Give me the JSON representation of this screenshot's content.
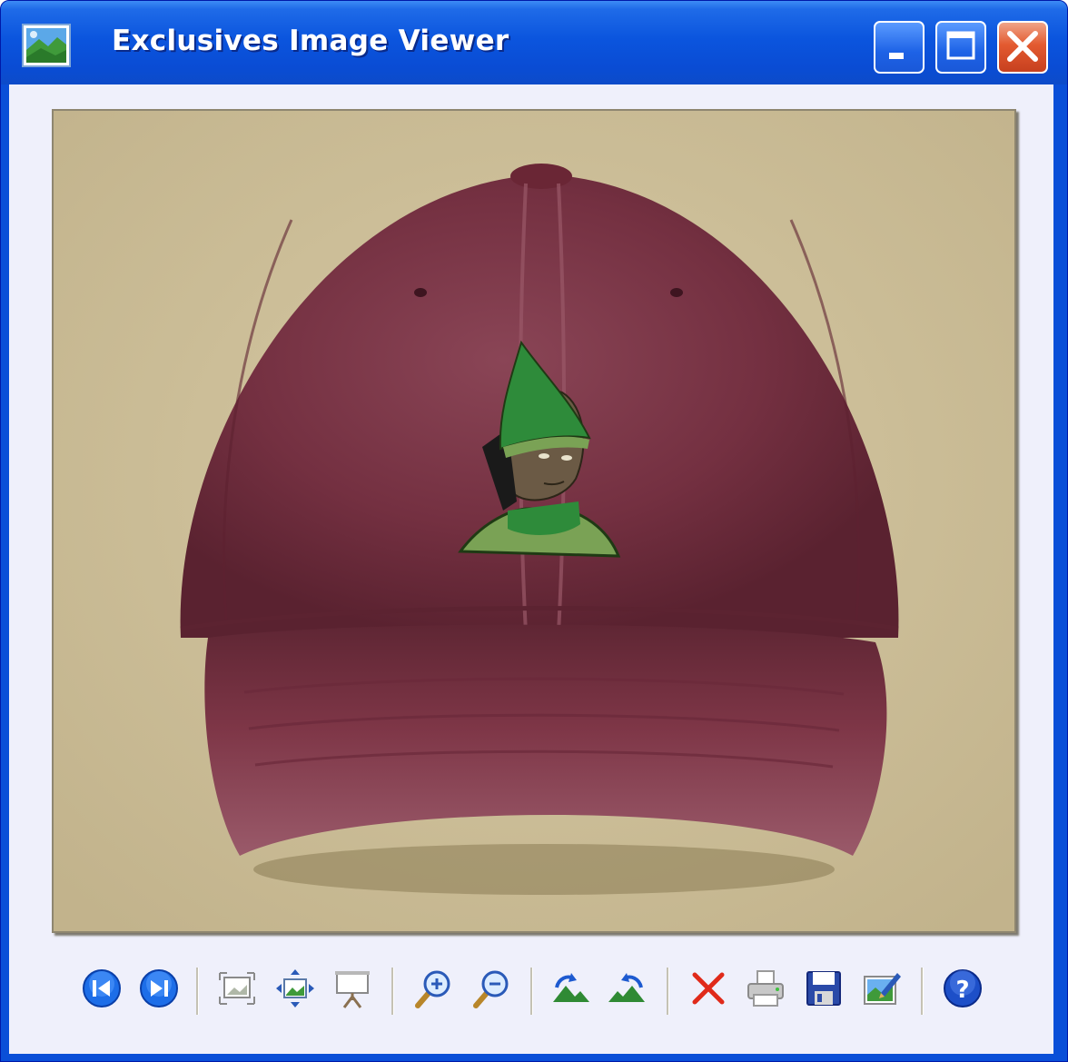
{
  "window": {
    "title": "Exclusives Image Viewer",
    "accent": "#0a4fd8"
  },
  "titlebar_buttons": [
    {
      "name": "minimize-button",
      "icon": "minimize-icon"
    },
    {
      "name": "maximize-button",
      "icon": "maximize-icon"
    },
    {
      "name": "close-button",
      "icon": "close-icon"
    }
  ],
  "image": {
    "subject": "hat-photo",
    "background_color": "#cbbd97",
    "hat_color": "#7a2f3f",
    "patch_colors": [
      "#2e8b3a",
      "#6b5a45",
      "#7aa255"
    ]
  },
  "toolbar": [
    {
      "name": "previous-image-button",
      "icon": "previous-icon"
    },
    {
      "name": "next-image-button",
      "icon": "next-icon"
    },
    {
      "name": "best-fit-button",
      "icon": "best-fit-icon"
    },
    {
      "name": "actual-size-button",
      "icon": "actual-size-icon"
    },
    {
      "name": "slideshow-button",
      "icon": "slideshow-icon"
    },
    {
      "name": "zoom-in-button",
      "icon": "zoom-in-icon"
    },
    {
      "name": "zoom-out-button",
      "icon": "zoom-out-icon"
    },
    {
      "name": "rotate-clockwise-button",
      "icon": "rotate-clockwise-icon"
    },
    {
      "name": "rotate-counterclockwise-button",
      "icon": "rotate-counterclockwise-icon"
    },
    {
      "name": "delete-button",
      "icon": "delete-icon"
    },
    {
      "name": "print-button",
      "icon": "print-icon"
    },
    {
      "name": "save-button",
      "icon": "save-icon"
    },
    {
      "name": "edit-image-button",
      "icon": "edit-image-icon"
    },
    {
      "name": "help-button",
      "icon": "help-icon"
    }
  ]
}
